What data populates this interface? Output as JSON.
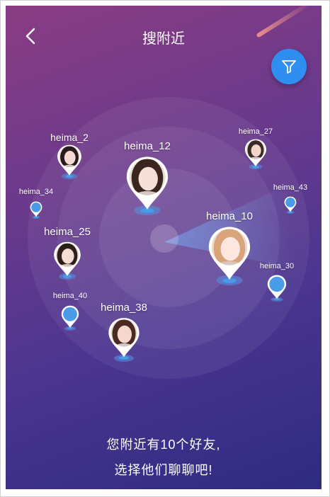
{
  "header": {
    "title": "搜附近"
  },
  "users": [
    {
      "name": "heima_2",
      "kind": "avatar",
      "hair": "#2a1c1c",
      "skin": "#f3d9cf"
    },
    {
      "name": "heima_12",
      "kind": "avatar",
      "hair": "#3b2520",
      "skin": "#f6e0d8"
    },
    {
      "name": "heima_27",
      "kind": "avatar",
      "hair": "#3a2a24",
      "skin": "#f2d6cc"
    },
    {
      "name": "heima_34",
      "kind": "dot"
    },
    {
      "name": "heima_43",
      "kind": "dot"
    },
    {
      "name": "heima_25",
      "kind": "avatar",
      "hair": "#2e1e1a",
      "skin": "#f4dcd2"
    },
    {
      "name": "heima_10",
      "kind": "avatar",
      "hair": "#d9a47a",
      "skin": "#fbe7df"
    },
    {
      "name": "heima_30",
      "kind": "dot"
    },
    {
      "name": "heima_40",
      "kind": "dot"
    },
    {
      "name": "heima_38",
      "kind": "avatar",
      "hair": "#4a2a22",
      "skin": "#f5d8cc"
    }
  ],
  "footer": {
    "line1": "您附近有10个好友,",
    "line2": "选择他们聊聊吧!"
  },
  "colors": {
    "filter": "#2f8ff0",
    "dot": "#4a9be8"
  },
  "icons": {
    "back": "chevron-left-icon",
    "filter": "funnel-icon"
  }
}
